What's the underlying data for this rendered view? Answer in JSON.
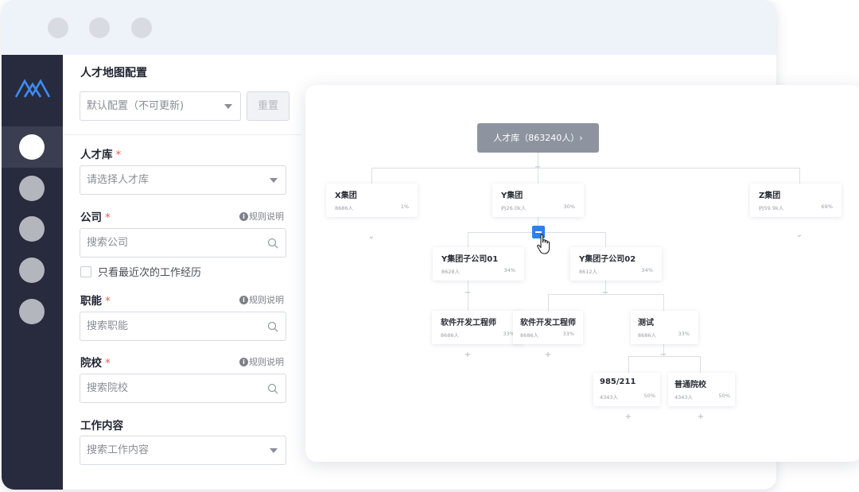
{
  "sidebar": {
    "nav_count": 5,
    "active_index": 0
  },
  "config": {
    "title": "人才地图配置",
    "preset_select": "默认配置（不可更新)",
    "reset_label": "重置",
    "rule_label": "规则说明",
    "talent_pool": {
      "label": "人才库",
      "placeholder": "请选择人才库"
    },
    "company": {
      "label": "公司",
      "placeholder": "搜索公司"
    },
    "latest_only": "只看最近次的工作经历",
    "function": {
      "label": "职能",
      "placeholder": "搜索职能"
    },
    "school": {
      "label": "院校",
      "placeholder": "搜索院校"
    },
    "work_content": {
      "label": "工作内容",
      "placeholder": "搜索工作内容"
    }
  },
  "tree": {
    "root": "人才库（863240人）›",
    "nodes": {
      "x": {
        "name": "X集团",
        "count": "8686人",
        "pct": "1%"
      },
      "y": {
        "name": "Y集团",
        "count": "约26.0k人",
        "pct": "30%"
      },
      "z": {
        "name": "Z集团",
        "count": "约59.9k人",
        "pct": "69%"
      },
      "y01": {
        "name": "Y集团子公司01",
        "count": "8628人",
        "pct": "34%"
      },
      "y02": {
        "name": "Y集团子公司02",
        "count": "8612人",
        "pct": "34%"
      },
      "sw1": {
        "name": "软件开发工程师",
        "count": "8686人",
        "pct": "33%"
      },
      "sw2": {
        "name": "软件开发工程师",
        "count": "8686人",
        "pct": "33%"
      },
      "test": {
        "name": "测试",
        "count": "8686人",
        "pct": "33%"
      },
      "s985": {
        "name": "985/211",
        "count": "4343人",
        "pct": "50%"
      },
      "general": {
        "name": "普通院校",
        "count": "4343人",
        "pct": "50%"
      }
    }
  },
  "colors": {
    "accent": "#2f7ef2",
    "sidebar": "#272b3d",
    "root_node": "#8e949f",
    "required": "#f0584a"
  }
}
